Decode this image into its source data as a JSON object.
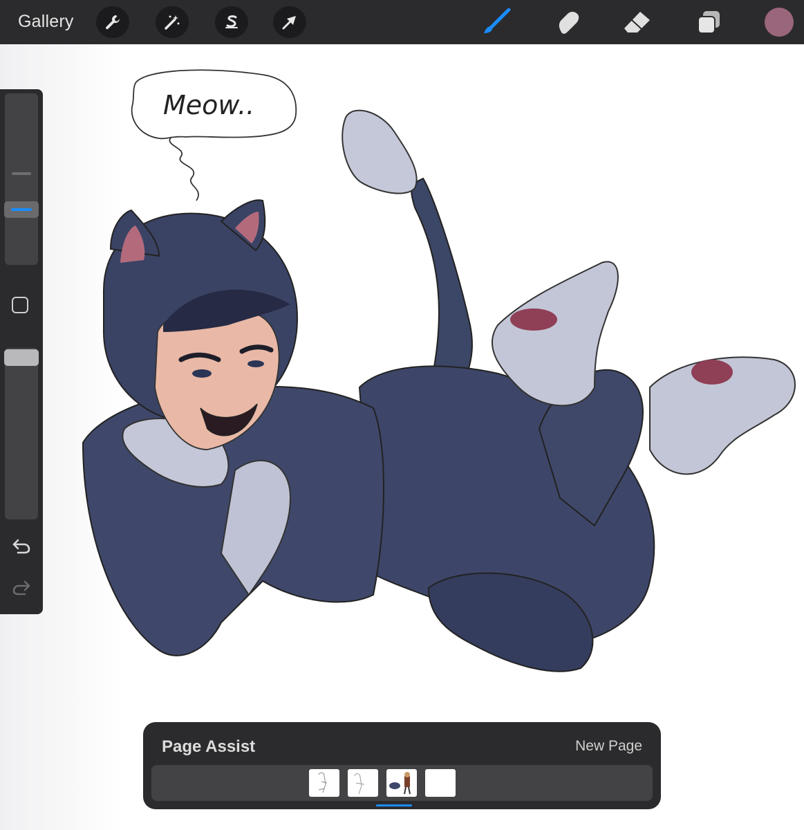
{
  "toolbar": {
    "gallery_label": "Gallery",
    "actions": [
      {
        "name": "wrench-icon",
        "label": "Actions"
      },
      {
        "name": "magic-wand-icon",
        "label": "Adjustments"
      },
      {
        "name": "selection-s-icon",
        "label": "Selection"
      },
      {
        "name": "transform-arrow-icon",
        "label": "Transform"
      }
    ],
    "tools": [
      {
        "name": "brush-icon",
        "active": true
      },
      {
        "name": "smudge-icon",
        "active": false
      },
      {
        "name": "eraser-icon",
        "active": false
      },
      {
        "name": "layers-icon",
        "active": false
      }
    ],
    "current_color": "#9a667c",
    "accent_color": "#1a8cff"
  },
  "canvas": {
    "speech_bubble_text": "Meow.."
  },
  "sidebar": {
    "brush_size_icon": "size-slider",
    "modifier_icon": "square-modifier-icon",
    "opacity_icon": "opacity-slider",
    "undo_icon": "undo-icon",
    "redo_icon": "redo-icon"
  },
  "page_assist": {
    "title": "Page Assist",
    "new_page_label": "New Page",
    "pages": [
      {
        "label": "page-1",
        "active": false
      },
      {
        "label": "page-2",
        "active": false
      },
      {
        "label": "page-3",
        "active": true
      },
      {
        "label": "page-4",
        "active": false
      }
    ]
  }
}
